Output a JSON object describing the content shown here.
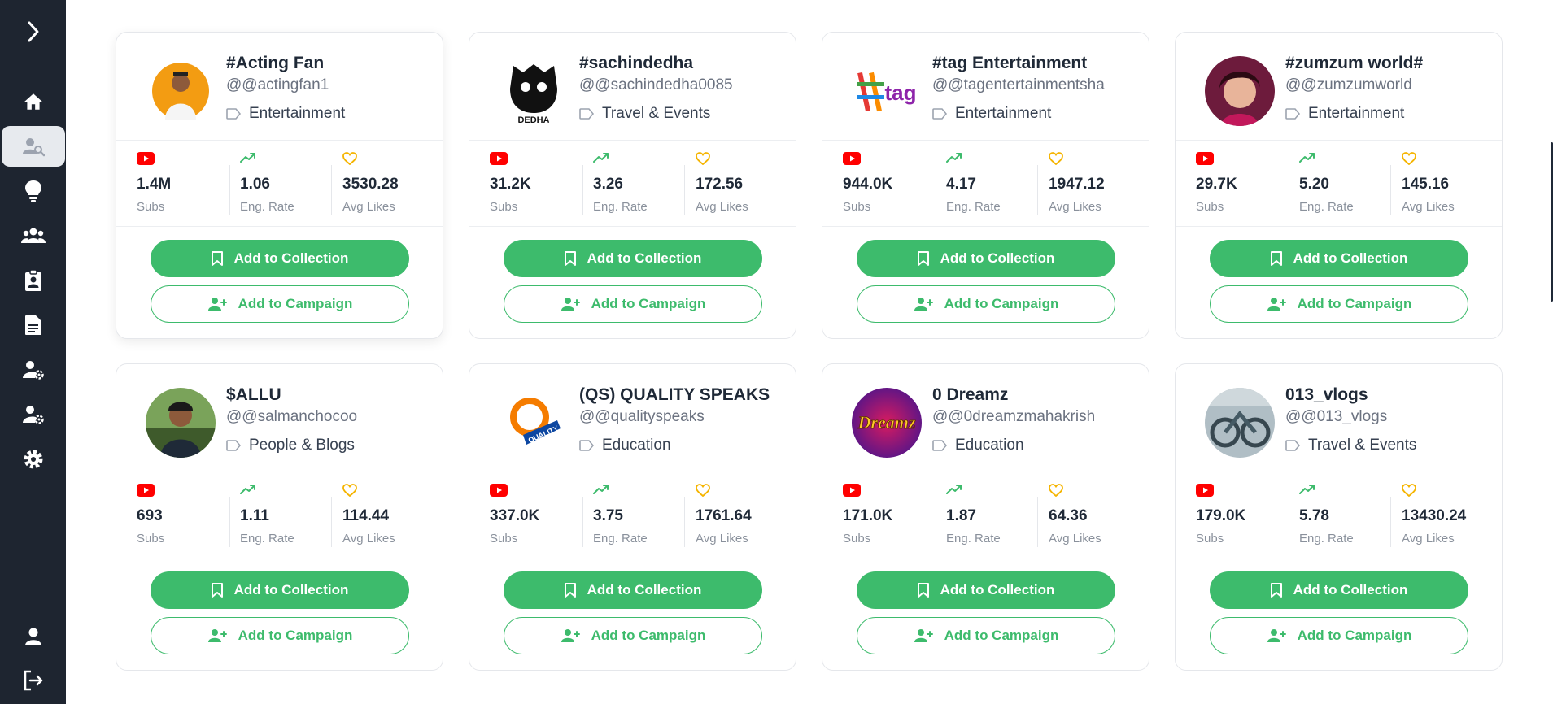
{
  "labels": {
    "subs": "Subs",
    "eng_rate": "Eng. Rate",
    "avg_likes": "Avg Likes",
    "add_to_collection": "Add to Collection",
    "add_to_campaign": "Add to Campaign"
  },
  "colors": {
    "sidebar_bg": "#1e2530",
    "accent_green": "#3dbb6c",
    "youtube_red": "#ff0000",
    "heart_yellow": "#f5b400"
  },
  "sidebar": {
    "items": [
      {
        "icon": "home-icon"
      },
      {
        "icon": "user-search-icon",
        "active": true
      },
      {
        "icon": "lightbulb-icon"
      },
      {
        "icon": "users-group-icon"
      },
      {
        "icon": "clipboard-user-icon"
      },
      {
        "icon": "document-icon"
      },
      {
        "icon": "user-settings-icon"
      },
      {
        "icon": "user-settings-icon"
      },
      {
        "icon": "gear-icon"
      }
    ],
    "bottom": [
      {
        "icon": "profile-icon"
      },
      {
        "icon": "logout-icon"
      }
    ]
  },
  "cards": [
    {
      "name": "#Acting Fan",
      "handle": "@@actingfan1",
      "category": "Entertainment",
      "subs": "1.4M",
      "eng_rate": "1.06",
      "avg_likes": "3530.28"
    },
    {
      "name": "#sachindedha",
      "handle": "@@sachindedha0085",
      "category": "Travel & Events",
      "subs": "31.2K",
      "eng_rate": "3.26",
      "avg_likes": "172.56",
      "logo_text": "DEDHA"
    },
    {
      "name": "#tag Entertainment",
      "handle": "@@tagentertainmentsha",
      "category": "Entertainment",
      "subs": "944.0K",
      "eng_rate": "4.17",
      "avg_likes": "1947.12",
      "logo_text": "#tag"
    },
    {
      "name": "#zumzum world#",
      "handle": "@@zumzumworld",
      "category": "Entertainment",
      "subs": "29.7K",
      "eng_rate": "5.20",
      "avg_likes": "145.16"
    },
    {
      "name": "$ALLU",
      "handle": "@@salmanchocoo",
      "category": "People & Blogs",
      "subs": "693",
      "eng_rate": "1.11",
      "avg_likes": "114.44"
    },
    {
      "name": "(QS) QUALITY SPEAKS",
      "handle": "@@qualityspeaks",
      "category": "Education",
      "subs": "337.0K",
      "eng_rate": "3.75",
      "avg_likes": "1761.64",
      "logo_text": "QUALITY"
    },
    {
      "name": "0 Dreamz",
      "handle": "@@0dreamzmahakrish",
      "category": "Education",
      "subs": "171.0K",
      "eng_rate": "1.87",
      "avg_likes": "64.36",
      "logo_text": "Dreamz"
    },
    {
      "name": "013_vlogs",
      "handle": "@@013_vlogs",
      "category": "Travel & Events",
      "subs": "179.0K",
      "eng_rate": "5.78",
      "avg_likes": "13430.24"
    }
  ]
}
